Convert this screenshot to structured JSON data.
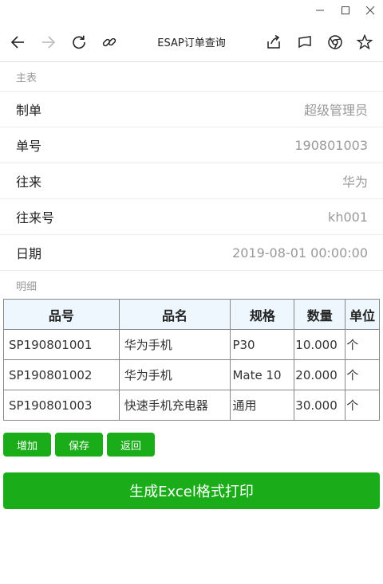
{
  "window": {
    "icons": [
      "minimize-icon",
      "maximize-icon",
      "close-icon"
    ]
  },
  "toolbar": {
    "title": "ESAP订单查询",
    "icons": [
      "back-arrow-icon",
      "forward-arrow-icon",
      "refresh-icon",
      "link-icon",
      "share-icon",
      "flag-icon",
      "chrome-icon",
      "star-icon"
    ]
  },
  "main": {
    "section_label": "主表",
    "fields": [
      {
        "label": "制单",
        "value": "超级管理员"
      },
      {
        "label": "单号",
        "value": "190801003"
      },
      {
        "label": "往来",
        "value": "华为"
      },
      {
        "label": "往来号",
        "value": "kh001"
      },
      {
        "label": "日期",
        "value": "2019-08-01 00:00:00"
      }
    ]
  },
  "detail": {
    "section_label": "明细",
    "columns": [
      "品号",
      "品名",
      "规格",
      "数量",
      "单位"
    ],
    "rows": [
      [
        "SP190801001",
        "华为手机",
        "P30",
        "10.000",
        "个"
      ],
      [
        "SP190801002",
        "华为手机",
        "Mate 10",
        "20.000",
        "个"
      ],
      [
        "SP190801003",
        "快速手机充电器",
        "通用",
        "30.000",
        "个"
      ]
    ]
  },
  "actions": {
    "add": "增加",
    "save": "保存",
    "back": "返回",
    "print": "生成Excel格式打印"
  },
  "colors": {
    "accent_green": "#1aad19",
    "header_bg": "#eef7fd",
    "muted_text": "#999999"
  }
}
